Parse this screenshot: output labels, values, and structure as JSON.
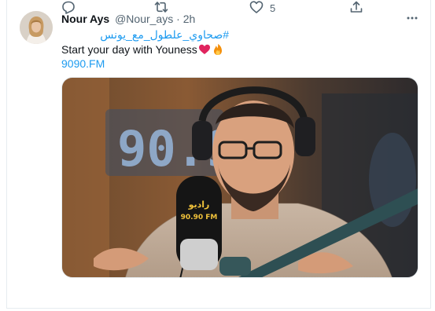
{
  "tweet": {
    "author_name": "Nour Ays",
    "author_handle": "@Nour_ays",
    "separator": "·",
    "time": "2h",
    "hashtag": "#صحاوي_علطول_مع_يونس",
    "text": "Start your day with Youness",
    "link": "9090.FM"
  },
  "media": {
    "sign_text": "90.90",
    "mic_logo_text": "90.90 FM",
    "mic_logo_arabic": "راديو"
  },
  "actions": {
    "reply_count": "",
    "retweet_count": "",
    "like_count": "5",
    "share_count": ""
  },
  "icons": {
    "more": "more-horizontal-icon",
    "reply": "reply-icon",
    "retweet": "retweet-icon",
    "like": "heart-icon",
    "share": "share-icon",
    "emoji_heart": "red-heart-emoji",
    "emoji_fire": "fire-emoji"
  },
  "colors": {
    "link": "#1d9bf0",
    "text": "#0f1419",
    "muted": "#536471",
    "border": "#e6ecf0"
  }
}
